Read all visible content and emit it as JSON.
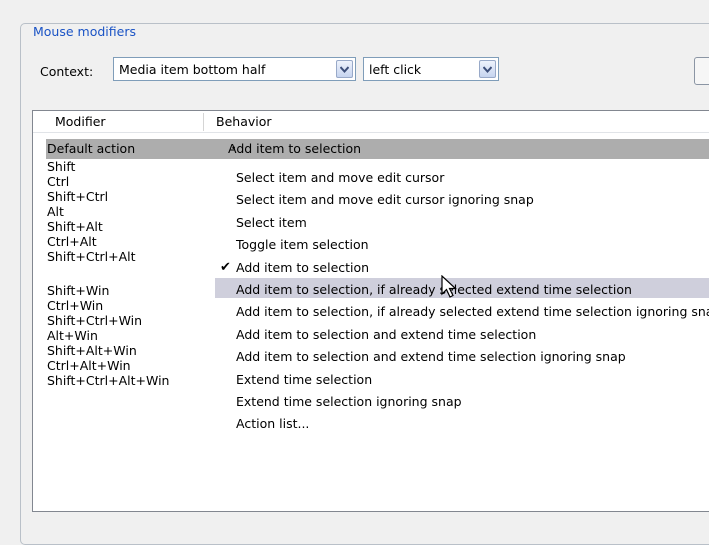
{
  "group": {
    "title": "Mouse modifiers"
  },
  "context": {
    "label": "Context:",
    "area_value": "Media item bottom half",
    "action_value": "left click"
  },
  "table": {
    "col_modifier": "Modifier",
    "col_behavior": "Behavior",
    "default_modifier": "Default action",
    "default_behavior": "Add item to selection",
    "modifiers": [
      "Shift",
      "Ctrl",
      "Shift+Ctrl",
      "Alt",
      "Shift+Alt",
      "Ctrl+Alt",
      "Shift+Ctrl+Alt",
      "",
      "Shift+Win",
      "Ctrl+Win",
      "Shift+Ctrl+Win",
      "Alt+Win",
      "Shift+Alt+Win",
      "Ctrl+Alt+Win",
      "Shift+Ctrl+Alt+Win"
    ],
    "behaviors": [
      "Select item and move edit cursor",
      "Select item and move edit cursor ignoring snap",
      "Select item",
      "Toggle item selection",
      "Add item to selection",
      "Add item to selection, if already selected extend time selection",
      "Add item to selection, if already selected extend time selection ignoring snap",
      "Add item to selection and extend time selection",
      "Add item to selection and extend time selection ignoring snap",
      "Extend time selection",
      "Extend time selection ignoring snap",
      "Action list..."
    ],
    "checked_index": 4
  },
  "colors": {
    "title_blue": "#1a53c5",
    "selection_gray": "#adadad",
    "hover_gray": "#cfcfdc"
  }
}
